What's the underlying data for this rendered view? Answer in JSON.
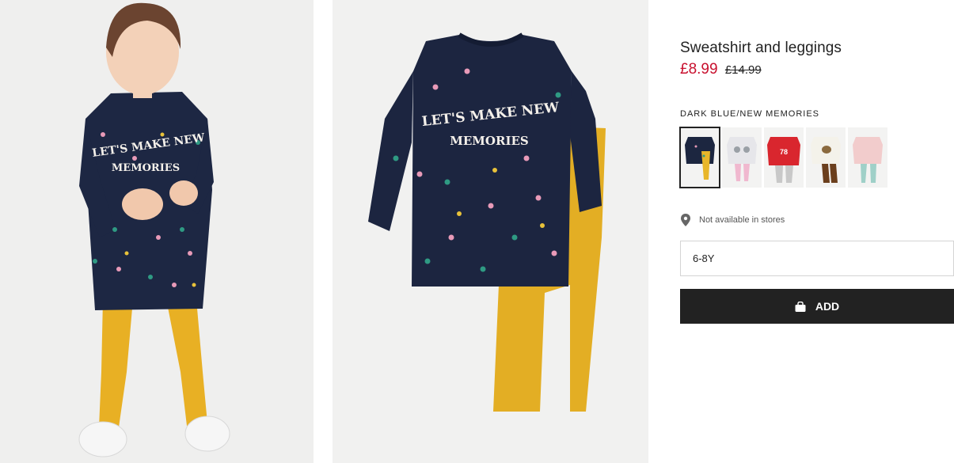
{
  "product": {
    "title": "Sweatshirt and leggings",
    "price_sale": "£8.99",
    "price_original": "£14.99",
    "color_name": "DARK BLUE/NEW MEMORIES"
  },
  "images": {
    "model_print_line1": "LET'S MAKE NEW",
    "model_print_line2": "MEMORIES",
    "flat_print_line1": "LET'S MAKE NEW",
    "flat_print_line2": "MEMORIES"
  },
  "swatches": [
    {
      "name": "dark-blue-new-memories",
      "top": "#1c2640",
      "bottom": "#e8b62a",
      "selected": true
    },
    {
      "name": "light-grey-bear",
      "top": "#e6e6ea",
      "bottom": "#f0b8cf",
      "selected": false
    },
    {
      "name": "red-78",
      "top": "#d9262e",
      "bottom": "#c8c8c8",
      "selected": false,
      "text": "78"
    },
    {
      "name": "white-reindeer",
      "top": "#f4f2ea",
      "bottom": "#6b3f1d",
      "selected": false
    },
    {
      "name": "pink-print",
      "top": "#f2cccc",
      "bottom": "#9fd0c8",
      "selected": false
    }
  ],
  "availability": {
    "icon": "location-pin-icon",
    "text": "Not available in stores"
  },
  "size": {
    "selected": "6-8Y"
  },
  "add_button": {
    "icon": "shopping-bag-icon",
    "label": "ADD"
  }
}
